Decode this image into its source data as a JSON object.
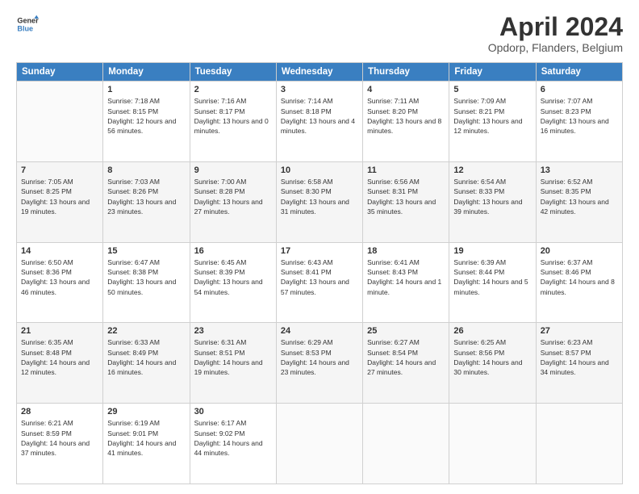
{
  "header": {
    "logo_line1": "General",
    "logo_line2": "Blue",
    "title": "April 2024",
    "subtitle": "Opdorp, Flanders, Belgium"
  },
  "weekdays": [
    "Sunday",
    "Monday",
    "Tuesday",
    "Wednesday",
    "Thursday",
    "Friday",
    "Saturday"
  ],
  "weeks": [
    [
      {
        "day": "",
        "sunrise": "",
        "sunset": "",
        "daylight": ""
      },
      {
        "day": "1",
        "sunrise": "Sunrise: 7:18 AM",
        "sunset": "Sunset: 8:15 PM",
        "daylight": "Daylight: 12 hours and 56 minutes."
      },
      {
        "day": "2",
        "sunrise": "Sunrise: 7:16 AM",
        "sunset": "Sunset: 8:17 PM",
        "daylight": "Daylight: 13 hours and 0 minutes."
      },
      {
        "day": "3",
        "sunrise": "Sunrise: 7:14 AM",
        "sunset": "Sunset: 8:18 PM",
        "daylight": "Daylight: 13 hours and 4 minutes."
      },
      {
        "day": "4",
        "sunrise": "Sunrise: 7:11 AM",
        "sunset": "Sunset: 8:20 PM",
        "daylight": "Daylight: 13 hours and 8 minutes."
      },
      {
        "day": "5",
        "sunrise": "Sunrise: 7:09 AM",
        "sunset": "Sunset: 8:21 PM",
        "daylight": "Daylight: 13 hours and 12 minutes."
      },
      {
        "day": "6",
        "sunrise": "Sunrise: 7:07 AM",
        "sunset": "Sunset: 8:23 PM",
        "daylight": "Daylight: 13 hours and 16 minutes."
      }
    ],
    [
      {
        "day": "7",
        "sunrise": "Sunrise: 7:05 AM",
        "sunset": "Sunset: 8:25 PM",
        "daylight": "Daylight: 13 hours and 19 minutes."
      },
      {
        "day": "8",
        "sunrise": "Sunrise: 7:03 AM",
        "sunset": "Sunset: 8:26 PM",
        "daylight": "Daylight: 13 hours and 23 minutes."
      },
      {
        "day": "9",
        "sunrise": "Sunrise: 7:00 AM",
        "sunset": "Sunset: 8:28 PM",
        "daylight": "Daylight: 13 hours and 27 minutes."
      },
      {
        "day": "10",
        "sunrise": "Sunrise: 6:58 AM",
        "sunset": "Sunset: 8:30 PM",
        "daylight": "Daylight: 13 hours and 31 minutes."
      },
      {
        "day": "11",
        "sunrise": "Sunrise: 6:56 AM",
        "sunset": "Sunset: 8:31 PM",
        "daylight": "Daylight: 13 hours and 35 minutes."
      },
      {
        "day": "12",
        "sunrise": "Sunrise: 6:54 AM",
        "sunset": "Sunset: 8:33 PM",
        "daylight": "Daylight: 13 hours and 39 minutes."
      },
      {
        "day": "13",
        "sunrise": "Sunrise: 6:52 AM",
        "sunset": "Sunset: 8:35 PM",
        "daylight": "Daylight: 13 hours and 42 minutes."
      }
    ],
    [
      {
        "day": "14",
        "sunrise": "Sunrise: 6:50 AM",
        "sunset": "Sunset: 8:36 PM",
        "daylight": "Daylight: 13 hours and 46 minutes."
      },
      {
        "day": "15",
        "sunrise": "Sunrise: 6:47 AM",
        "sunset": "Sunset: 8:38 PM",
        "daylight": "Daylight: 13 hours and 50 minutes."
      },
      {
        "day": "16",
        "sunrise": "Sunrise: 6:45 AM",
        "sunset": "Sunset: 8:39 PM",
        "daylight": "Daylight: 13 hours and 54 minutes."
      },
      {
        "day": "17",
        "sunrise": "Sunrise: 6:43 AM",
        "sunset": "Sunset: 8:41 PM",
        "daylight": "Daylight: 13 hours and 57 minutes."
      },
      {
        "day": "18",
        "sunrise": "Sunrise: 6:41 AM",
        "sunset": "Sunset: 8:43 PM",
        "daylight": "Daylight: 14 hours and 1 minute."
      },
      {
        "day": "19",
        "sunrise": "Sunrise: 6:39 AM",
        "sunset": "Sunset: 8:44 PM",
        "daylight": "Daylight: 14 hours and 5 minutes."
      },
      {
        "day": "20",
        "sunrise": "Sunrise: 6:37 AM",
        "sunset": "Sunset: 8:46 PM",
        "daylight": "Daylight: 14 hours and 8 minutes."
      }
    ],
    [
      {
        "day": "21",
        "sunrise": "Sunrise: 6:35 AM",
        "sunset": "Sunset: 8:48 PM",
        "daylight": "Daylight: 14 hours and 12 minutes."
      },
      {
        "day": "22",
        "sunrise": "Sunrise: 6:33 AM",
        "sunset": "Sunset: 8:49 PM",
        "daylight": "Daylight: 14 hours and 16 minutes."
      },
      {
        "day": "23",
        "sunrise": "Sunrise: 6:31 AM",
        "sunset": "Sunset: 8:51 PM",
        "daylight": "Daylight: 14 hours and 19 minutes."
      },
      {
        "day": "24",
        "sunrise": "Sunrise: 6:29 AM",
        "sunset": "Sunset: 8:53 PM",
        "daylight": "Daylight: 14 hours and 23 minutes."
      },
      {
        "day": "25",
        "sunrise": "Sunrise: 6:27 AM",
        "sunset": "Sunset: 8:54 PM",
        "daylight": "Daylight: 14 hours and 27 minutes."
      },
      {
        "day": "26",
        "sunrise": "Sunrise: 6:25 AM",
        "sunset": "Sunset: 8:56 PM",
        "daylight": "Daylight: 14 hours and 30 minutes."
      },
      {
        "day": "27",
        "sunrise": "Sunrise: 6:23 AM",
        "sunset": "Sunset: 8:57 PM",
        "daylight": "Daylight: 14 hours and 34 minutes."
      }
    ],
    [
      {
        "day": "28",
        "sunrise": "Sunrise: 6:21 AM",
        "sunset": "Sunset: 8:59 PM",
        "daylight": "Daylight: 14 hours and 37 minutes."
      },
      {
        "day": "29",
        "sunrise": "Sunrise: 6:19 AM",
        "sunset": "Sunset: 9:01 PM",
        "daylight": "Daylight: 14 hours and 41 minutes."
      },
      {
        "day": "30",
        "sunrise": "Sunrise: 6:17 AM",
        "sunset": "Sunset: 9:02 PM",
        "daylight": "Daylight: 14 hours and 44 minutes."
      },
      {
        "day": "",
        "sunrise": "",
        "sunset": "",
        "daylight": ""
      },
      {
        "day": "",
        "sunrise": "",
        "sunset": "",
        "daylight": ""
      },
      {
        "day": "",
        "sunrise": "",
        "sunset": "",
        "daylight": ""
      },
      {
        "day": "",
        "sunrise": "",
        "sunset": "",
        "daylight": ""
      }
    ]
  ]
}
